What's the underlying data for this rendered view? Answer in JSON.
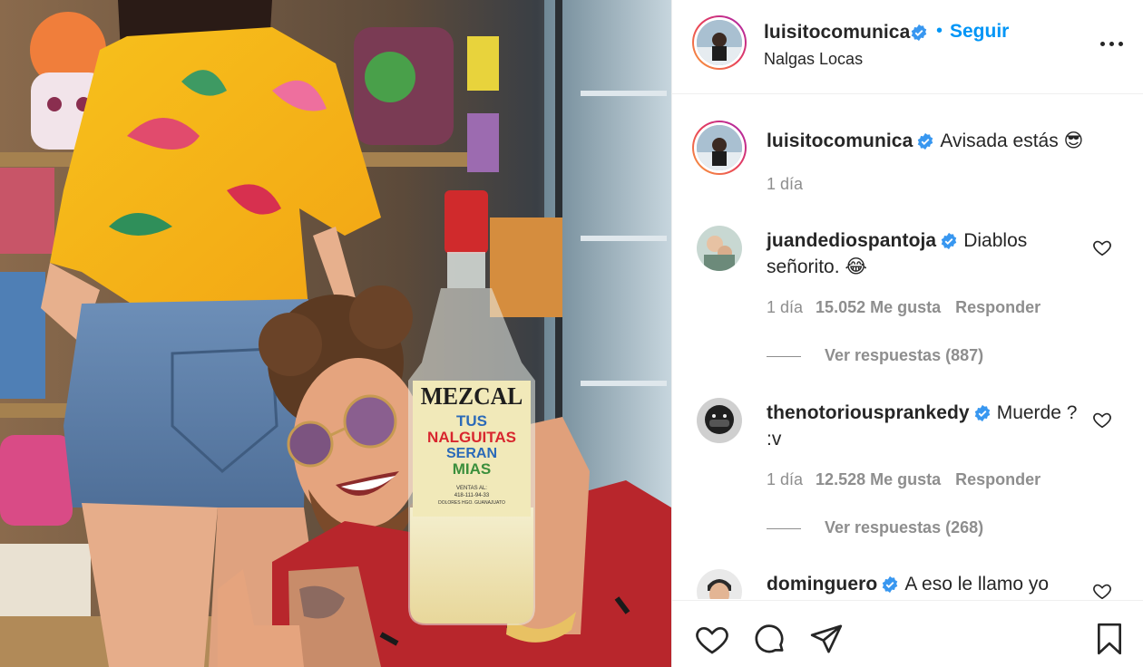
{
  "post": {
    "author": "luisitocomunica",
    "follow_label": "Seguir",
    "separator": "•",
    "location": "Nalgas Locas",
    "photo_label": {
      "brand": "MEZCAL",
      "line1": "TUS",
      "line2": "NALGUITAS",
      "line3": "SERAN",
      "line4": "MIAS",
      "small1": "VENTAS AL:",
      "small2": "418-111-94-33",
      "small3": "DOLORES HGO. GUANAJUATO"
    }
  },
  "caption": {
    "author": "luisitocomunica",
    "text": "Avisada estás 😎",
    "time": "1 día"
  },
  "comments": [
    {
      "author": "juandediospantoja",
      "text": "Diablos señorito. 😂",
      "time": "1 día",
      "likes": "15.052 Me gusta",
      "reply": "Responder",
      "view_replies": "Ver respuestas (887)"
    },
    {
      "author": "thenotoriousprankedy",
      "text": "Muerde ? :v",
      "time": "1 día",
      "likes": "12.528 Me gusta",
      "reply": "Responder",
      "view_replies": "Ver respuestas (268)"
    },
    {
      "author": "dominguero",
      "text": "A eso le llamo yo",
      "time": "",
      "likes": "",
      "reply": "",
      "view_replies": ""
    }
  ],
  "icons": {
    "more": "more-options-icon",
    "verified": "verified-badge-icon",
    "like": "heart-icon",
    "comment": "comment-icon",
    "share": "share-icon",
    "save": "bookmark-icon"
  },
  "colors": {
    "accent": "#0095f6",
    "verified": "#3897f0",
    "text": "#262626",
    "muted": "#8e8e8e",
    "border": "#efefef"
  }
}
